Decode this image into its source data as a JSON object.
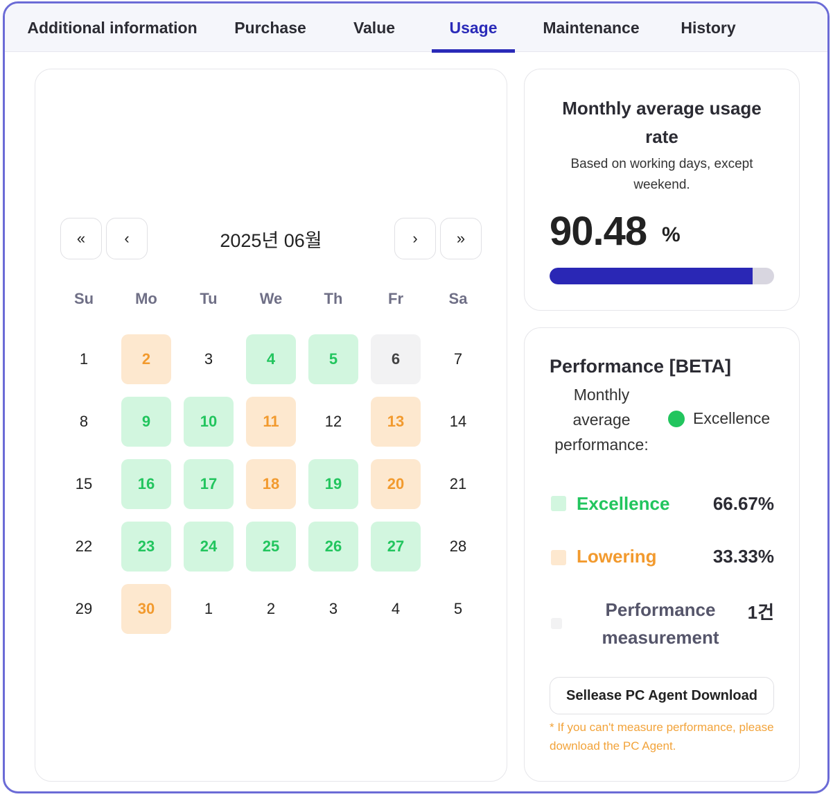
{
  "tabs": [
    {
      "label": "Additional information",
      "active": false
    },
    {
      "label": "Purchase",
      "active": false
    },
    {
      "label": "Value",
      "active": false
    },
    {
      "label": "Usage",
      "active": true
    },
    {
      "label": "Maintenance",
      "active": false
    },
    {
      "label": "History",
      "active": false
    }
  ],
  "calendar": {
    "title": "2025년 06월",
    "nav": {
      "first": "«",
      "prev": "‹",
      "next": "›",
      "last": "»"
    },
    "weekdays": [
      "Su",
      "Mo",
      "Tu",
      "We",
      "Th",
      "Fr",
      "Sa"
    ],
    "weeks": [
      [
        {
          "d": "1",
          "s": ""
        },
        {
          "d": "2",
          "s": "low"
        },
        {
          "d": "3",
          "s": ""
        },
        {
          "d": "4",
          "s": "good"
        },
        {
          "d": "5",
          "s": "good"
        },
        {
          "d": "6",
          "s": "none"
        },
        {
          "d": "7",
          "s": ""
        }
      ],
      [
        {
          "d": "8",
          "s": ""
        },
        {
          "d": "9",
          "s": "good"
        },
        {
          "d": "10",
          "s": "good"
        },
        {
          "d": "11",
          "s": "low"
        },
        {
          "d": "12",
          "s": ""
        },
        {
          "d": "13",
          "s": "low"
        },
        {
          "d": "14",
          "s": ""
        }
      ],
      [
        {
          "d": "15",
          "s": ""
        },
        {
          "d": "16",
          "s": "good"
        },
        {
          "d": "17",
          "s": "good"
        },
        {
          "d": "18",
          "s": "low"
        },
        {
          "d": "19",
          "s": "good"
        },
        {
          "d": "20",
          "s": "low"
        },
        {
          "d": "21",
          "s": ""
        }
      ],
      [
        {
          "d": "22",
          "s": ""
        },
        {
          "d": "23",
          "s": "good"
        },
        {
          "d": "24",
          "s": "good"
        },
        {
          "d": "25",
          "s": "good"
        },
        {
          "d": "26",
          "s": "good"
        },
        {
          "d": "27",
          "s": "good"
        },
        {
          "d": "28",
          "s": ""
        }
      ],
      [
        {
          "d": "29",
          "s": ""
        },
        {
          "d": "30",
          "s": "low"
        },
        {
          "d": "1",
          "s": ""
        },
        {
          "d": "2",
          "s": ""
        },
        {
          "d": "3",
          "s": ""
        },
        {
          "d": "4",
          "s": ""
        },
        {
          "d": "5",
          "s": ""
        }
      ]
    ]
  },
  "usage": {
    "title": "Monthly average usage rate",
    "subtitle": "Based on working days, except weekend.",
    "value": "90.48",
    "unit": "%",
    "progress_percent": 90.48
  },
  "performance": {
    "title": "Performance [BETA]",
    "label": "Monthly average performance:",
    "status": "Excellence",
    "status_color": "#22c55e",
    "legend": [
      {
        "label": "Excellence",
        "value": "66.67%",
        "color": "#22c55e",
        "swatch": "#d2f6df"
      },
      {
        "label": "Lowering",
        "value": "33.33%",
        "color": "#f29a2e",
        "swatch": "#fde8cf"
      },
      {
        "label": "Performance measurement",
        "value": "1건",
        "color": "#55556a",
        "swatch": "#f2f2f3"
      }
    ],
    "download_label": "Sellease PC Agent Download",
    "note": "* If you can't measure performance, please download the PC Agent."
  }
}
